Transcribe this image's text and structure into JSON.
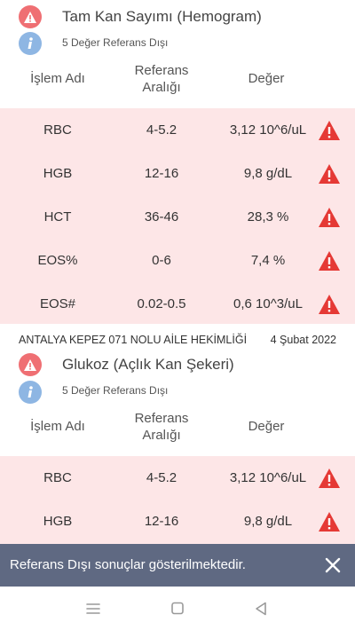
{
  "section1": {
    "title": "Tam Kan Sayımı (Hemogram)",
    "subtitle": "5 Değer Referans Dışı",
    "col_name": "İşlem Adı",
    "col_range_line1": "Referans",
    "col_range_line2": "Aralığı",
    "col_value": "Değer",
    "rows": [
      {
        "name": "RBC",
        "range": "4-5.2",
        "value": "3,12 10^6/uL"
      },
      {
        "name": "HGB",
        "range": "12-16",
        "value": "9,8 g/dL"
      },
      {
        "name": "HCT",
        "range": "36-46",
        "value": "28,3 %"
      },
      {
        "name": "EOS%",
        "range": "0-6",
        "value": "7,4 %"
      },
      {
        "name": "EOS#",
        "range": "0.02-0.5",
        "value": "0,6 10^3/uL"
      }
    ]
  },
  "footer": {
    "clinic": "ANTALYA KEPEZ 071 NOLU AİLE HEKİMLİĞİ",
    "date": "4 Şubat 2022"
  },
  "section2": {
    "title": "Glukoz (Açlık Kan Şekeri)",
    "subtitle": "5 Değer Referans Dışı",
    "col_name": "İşlem Adı",
    "col_range_line1": "Referans",
    "col_range_line2": "Aralığı",
    "col_value": "Değer",
    "rows": [
      {
        "name": "RBC",
        "range": "4-5.2",
        "value": "3,12 10^6/uL"
      },
      {
        "name": "HGB",
        "range": "12-16",
        "value": "9,8 g/dL"
      }
    ]
  },
  "snackbar": {
    "message": "Referans Dışı sonuçlar gösterilmektedir."
  },
  "icons": {
    "alert": "exclamation-triangle-icon",
    "info": "info-icon",
    "warning": "warning-triangle-icon",
    "close": "close-icon",
    "menu": "menu-icon",
    "home": "home-square-icon",
    "back": "back-triangle-icon"
  },
  "colors": {
    "alert_red": "#e53935",
    "circle_red": "#ef6f73",
    "circle_blue": "#8eb6e3",
    "row_pink": "#fde6e7",
    "snackbar": "#5f6982"
  }
}
